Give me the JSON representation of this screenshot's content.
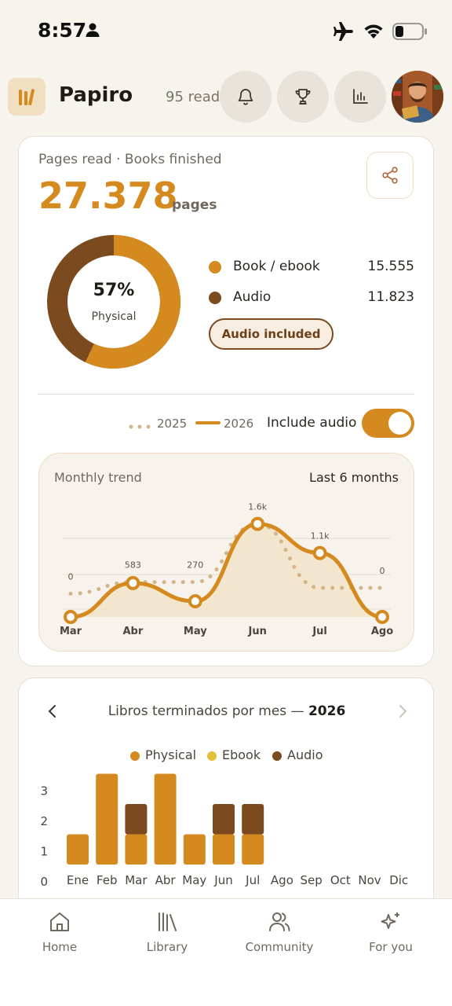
{
  "status": {
    "time": "8:57"
  },
  "header": {
    "app_name": "Papiro",
    "read_count": "95 read"
  },
  "summary": {
    "subtitle": "Pages read · Books finished",
    "total_pages": "27.378",
    "pages_unit": "pages",
    "donut_percent": "57%",
    "donut_percent_value": 57,
    "donut_label": "Physical",
    "legend": [
      {
        "name": "Book / ebook",
        "value": "15.555",
        "color": "#d48a1f"
      },
      {
        "name": "Audio",
        "value": "11.823",
        "color": "#7b4a1f"
      }
    ],
    "audio_pill": "Audio included"
  },
  "controls": {
    "year_prev": "2025",
    "year_curr": "2026",
    "include_audio_label": "Include audio",
    "include_audio_on": true
  },
  "trend": {
    "title": "Monthly trend",
    "range": "Last 6 months",
    "chart_data": {
      "type": "line",
      "categories": [
        "Mar",
        "Abr",
        "May",
        "Jun",
        "Jul",
        "Ago"
      ],
      "series": [
        {
          "name": "2025",
          "values": [
            400,
            600,
            600,
            1600,
            500,
            500
          ]
        },
        {
          "name": "2026",
          "values": [
            0,
            583,
            270,
            1600,
            1100,
            0
          ]
        }
      ],
      "point_labels": [
        "0",
        "583",
        "270",
        "1.6k",
        "1.1k",
        "0"
      ],
      "ylim": [
        0,
        2000
      ],
      "grid": true,
      "colors": {
        "2025": "#d4b58a",
        "2026": "#d48a1f"
      }
    }
  },
  "books": {
    "title": "Libros terminados por mes — ",
    "year": "2026",
    "legend": [
      {
        "name": "Physical",
        "color": "#d48a1f"
      },
      {
        "name": "Ebook",
        "color": "#e3c03a"
      },
      {
        "name": "Audio",
        "color": "#7b4a1f"
      }
    ],
    "chart_data": {
      "type": "bar",
      "categories": [
        "Ene",
        "Feb",
        "Mar",
        "Abr",
        "May",
        "Jun",
        "Jul",
        "Ago",
        "Sep",
        "Oct",
        "Nov",
        "Dic"
      ],
      "series": [
        {
          "name": "Physical",
          "values": [
            1,
            3,
            1,
            3,
            1,
            1,
            1,
            0,
            0,
            0,
            0,
            0
          ]
        },
        {
          "name": "Ebook",
          "values": [
            0,
            0,
            0,
            0,
            0,
            0,
            0,
            0,
            0,
            0,
            0,
            0
          ]
        },
        {
          "name": "Audio",
          "values": [
            0,
            0,
            1,
            0,
            0,
            1,
            1,
            0,
            0,
            0,
            0,
            0
          ]
        }
      ],
      "yticks": [
        "0",
        "1",
        "2",
        "3"
      ],
      "ylim": [
        0,
        3
      ]
    }
  },
  "bottom_nav": [
    {
      "label": "Home",
      "icon": "home-icon"
    },
    {
      "label": "Library",
      "icon": "library-icon"
    },
    {
      "label": "Community",
      "icon": "community-icon"
    },
    {
      "label": "For you",
      "icon": "sparkle-icon"
    }
  ]
}
